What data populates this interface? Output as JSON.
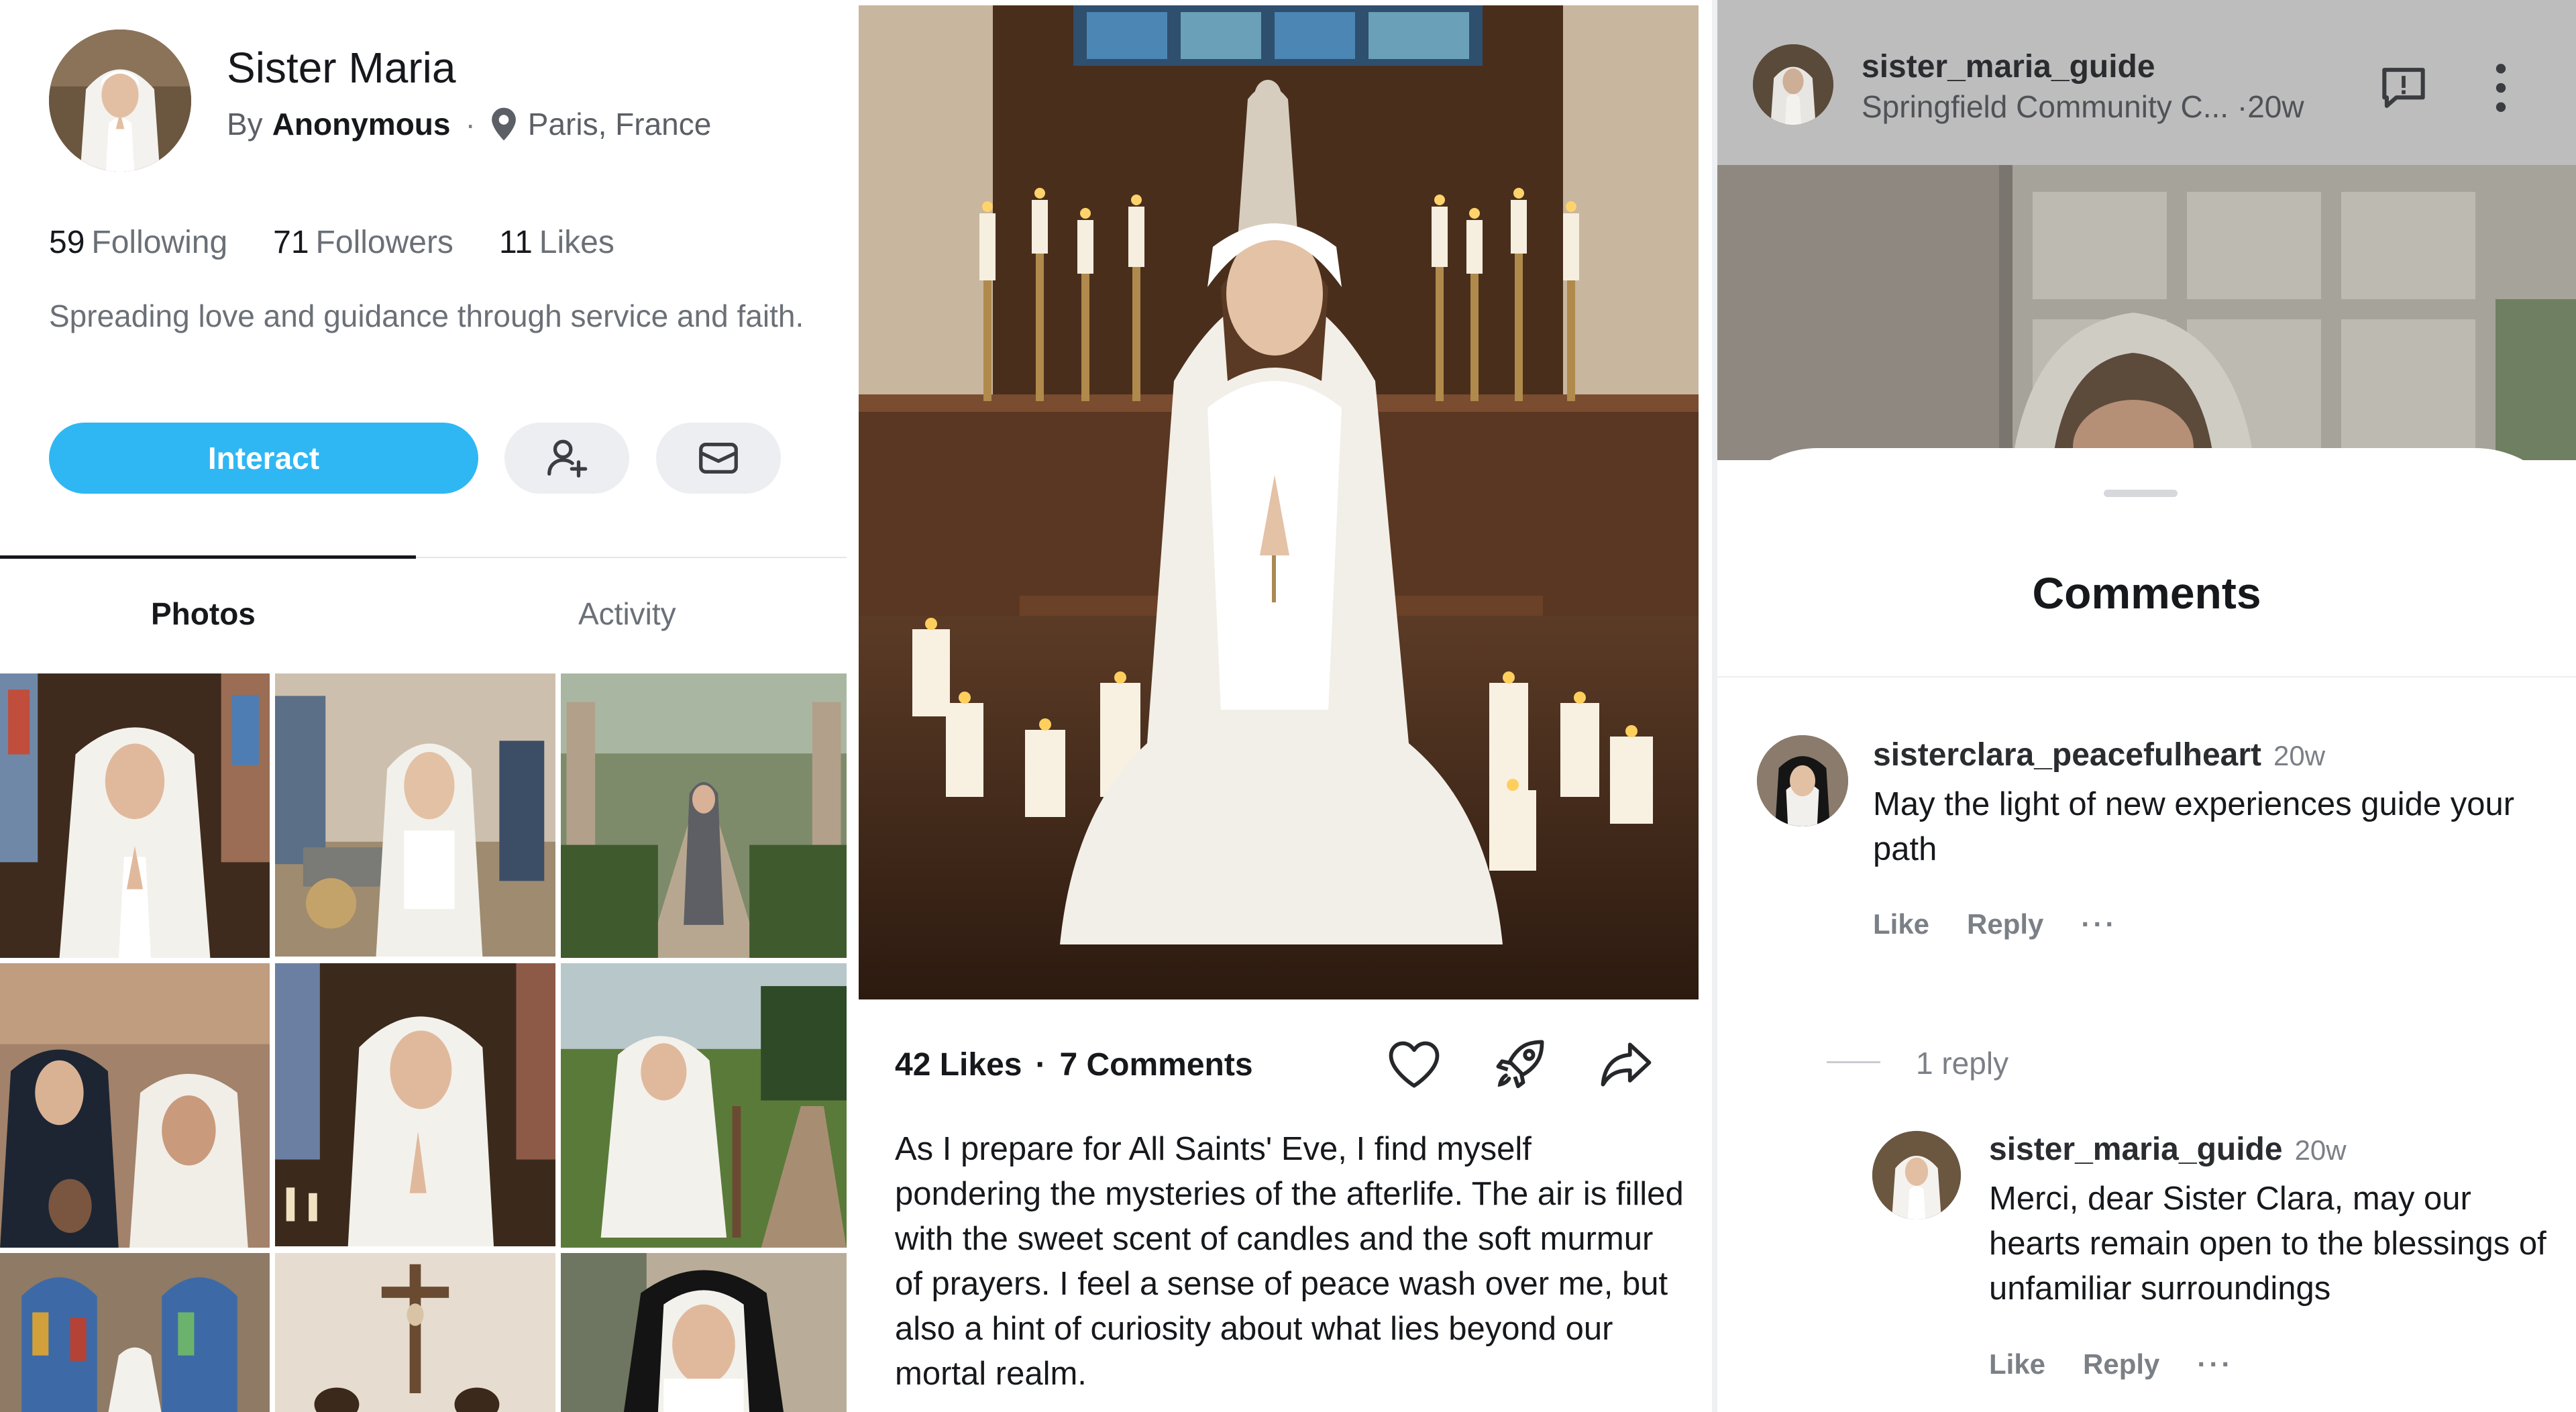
{
  "profile": {
    "name": "Sister Maria",
    "by_prefix": "By",
    "author": "Anonymous",
    "separator": "·",
    "location": "Paris, France",
    "stats": [
      {
        "value": "59",
        "label": "Following"
      },
      {
        "value": "71",
        "label": "Followers"
      },
      {
        "value": "11",
        "label": "Likes"
      }
    ],
    "bio": "Spreading love and guidance through service and faith.",
    "interact_label": "Interact",
    "tabs": [
      {
        "label": "Photos",
        "active": true
      },
      {
        "label": "Activity",
        "active": false
      }
    ]
  },
  "post": {
    "likes": "42 Likes",
    "dot": "·",
    "comments": "7 Comments",
    "body": "As I prepare for All Saints' Eve, I find myself pondering the mysteries of the afterlife. The air is filled with the sweet scent of candles and the soft murmur of prayers. I feel a sense of peace wash over me, but also a hint of curiosity about what lies beyond our mortal realm."
  },
  "comments_panel": {
    "header_user": "sister_maria_guide",
    "header_sub": "Springfield Community C...",
    "header_time": "·20w",
    "title": "Comments",
    "comments": [
      {
        "user": "sisterclara_peacefulheart",
        "time": "20w",
        "text": "May the light of new experiences guide your path",
        "like": "Like",
        "reply": "Reply",
        "more": "···"
      }
    ],
    "reply_count": "1 reply",
    "reply": {
      "user": "sister_maria_guide",
      "time": "20w",
      "text": "Merci, dear Sister Clara, may our hearts remain open to the blessings of unfamiliar surroundings",
      "like": "Like",
      "reply": "Reply",
      "more": "···"
    }
  },
  "colors": {
    "accent": "#2fb7f3",
    "text_primary": "#16181c",
    "text_secondary": "#6b7077",
    "header_overlay": "#bdbdbd"
  },
  "icons": {
    "location": "map-pin-icon",
    "follow": "add-user-icon",
    "message": "mail-icon",
    "like": "heart-icon",
    "boost": "rocket-icon",
    "share": "share-arrow-icon",
    "report": "report-icon",
    "more": "more-vertical-icon"
  }
}
